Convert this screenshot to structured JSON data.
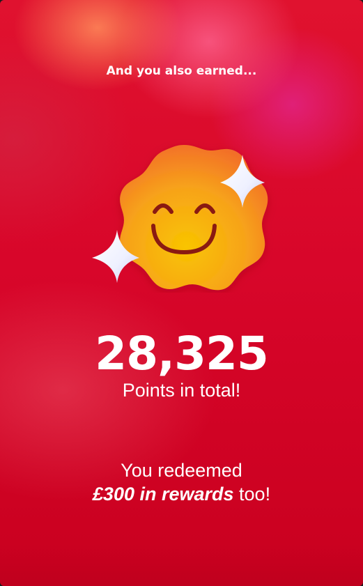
{
  "card": {
    "subtitle": "And you also earned...",
    "mascot_icon": "smiling-badge-icon",
    "sparkle_icon": "sparkle-icon",
    "points_value": "28,325",
    "points_label": "Points in total!",
    "redeem_line1": "You redeemed",
    "redeem_amount": "£300 in rewards",
    "redeem_suffix": " too!"
  },
  "colors": {
    "background": "#d9062a",
    "badge_orange": "#f7941d",
    "badge_yellow": "#f9c400",
    "face": "#8a1a12",
    "text": "#ffffff"
  }
}
